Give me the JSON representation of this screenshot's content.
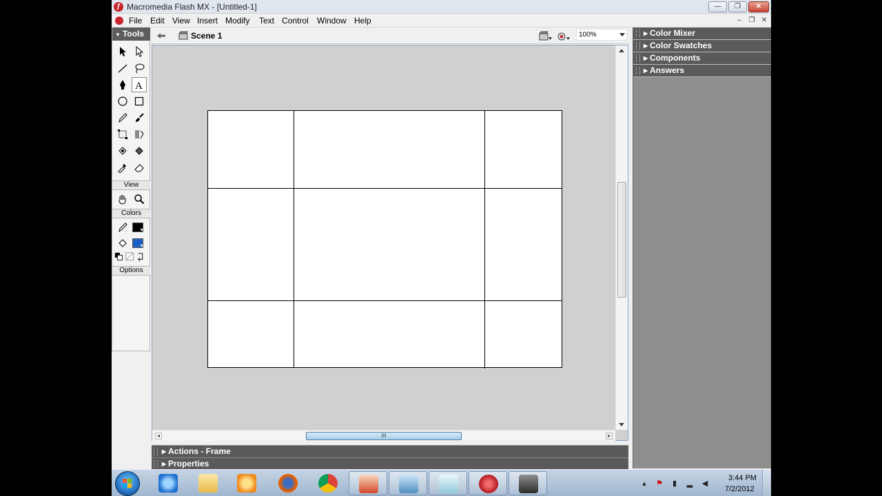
{
  "window": {
    "title": "Macromedia Flash MX - [Untitled-1]",
    "minimize_label": "—",
    "maximize_label": "❐",
    "close_label": "✕"
  },
  "menu": {
    "items": [
      "File",
      "Edit",
      "View",
      "Insert",
      "Modify",
      "Text",
      "Control",
      "Window",
      "Help"
    ],
    "doc_min": "–",
    "doc_restore": "❐",
    "doc_close": "✕"
  },
  "tools": {
    "header": "Tools",
    "view_label": "View",
    "colors_label": "Colors",
    "options_label": "Options",
    "active_tool": "text-tool",
    "stroke_color": "#000000",
    "fill_color": "#1a5fbf"
  },
  "scene": {
    "label": "Scene 1",
    "zoom": "100%"
  },
  "stage": {
    "background": "#ffffff",
    "area_color": "#d0d0d0",
    "scrollbar_grip": "III"
  },
  "bottom_panels": {
    "actions": "Actions - Frame",
    "properties": "Properties"
  },
  "right_panels": [
    "Color Mixer",
    "Color Swatches",
    "Components",
    "Answers"
  ],
  "taskbar": {
    "time": "3:44 PM",
    "date": "7/2/2012",
    "apps": [
      "internet-explorer",
      "file-explorer",
      "media-player",
      "firefox",
      "chrome",
      "powerpoint",
      "photo-viewer",
      "notepad-app",
      "flash-mx",
      "camera-app"
    ]
  }
}
